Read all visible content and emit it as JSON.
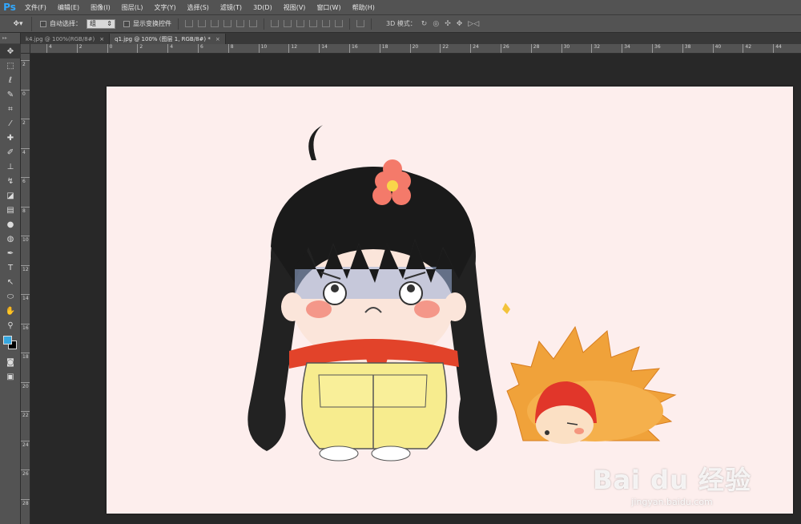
{
  "app": {
    "logo": "Ps"
  },
  "menu": [
    "文件(F)",
    "编辑(E)",
    "图像(I)",
    "图层(L)",
    "文字(Y)",
    "选择(S)",
    "滤镜(T)",
    "3D(D)",
    "视图(V)",
    "窗口(W)",
    "帮助(H)"
  ],
  "options": {
    "auto_select_label": "自动选择：",
    "auto_select_value": "组",
    "show_transform_label": "显示变换控件",
    "mode_label": "3D 模式："
  },
  "tabs": [
    {
      "label": "k4.jpg @ 100%(RGB/8#)",
      "close": "×"
    },
    {
      "label": "q1.jpg @ 100% (图层 1, RGB/8#) *",
      "close": "×"
    }
  ],
  "ruler_h": [
    "4",
    "2",
    "0",
    "2",
    "4",
    "6",
    "8",
    "10",
    "12",
    "14",
    "16",
    "18",
    "20",
    "22",
    "24",
    "26",
    "28",
    "30",
    "32",
    "34",
    "36",
    "38",
    "40",
    "42",
    "44"
  ],
  "ruler_v": [
    "2",
    "0",
    "2",
    "4",
    "6",
    "8",
    "10",
    "12",
    "14",
    "16",
    "18",
    "20",
    "22",
    "24",
    "26",
    "28"
  ],
  "colors": {
    "foreground": "#35a7e0",
    "background": "#000000",
    "canvas": "#fdeeed",
    "accent": "#31a8ff"
  },
  "watermark": {
    "main": "Bai du 经验",
    "sub": "jingyan.baidu.com"
  }
}
